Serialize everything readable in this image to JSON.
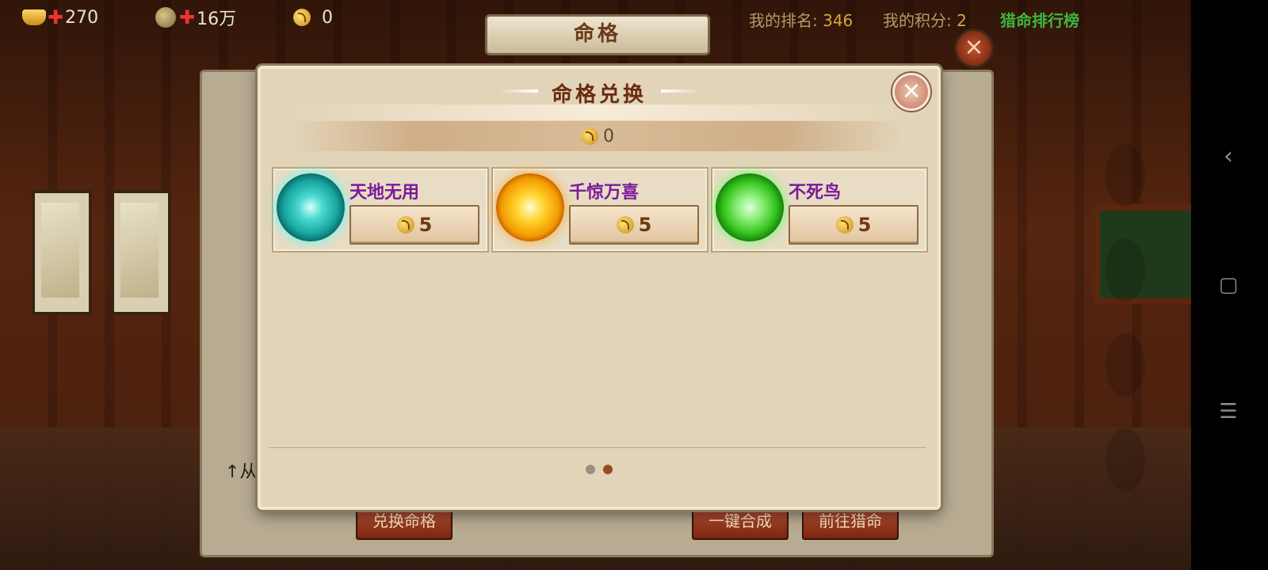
{
  "topbar": {
    "gold": "270",
    "coins": "16万",
    "souls": "0",
    "rank_label": "我的排名:",
    "rank_value": "346",
    "score_label": "我的积分:",
    "score_value": "2",
    "rank_list_label": "猎命排行榜"
  },
  "background_panel": {
    "title": "命格",
    "close_icon": "×",
    "hint_text": "↑从",
    "buttons": {
      "exchange": "兑换命格",
      "merge": "一键合成",
      "hunt": "前往猎命"
    }
  },
  "dialog": {
    "title": "命格兑换",
    "close_icon": "×",
    "currency_value": "0",
    "items": [
      {
        "name": "天地无用",
        "price": "5",
        "color": "#3fd9cf"
      },
      {
        "name": "千惊万喜",
        "price": "5",
        "color": "#f5a50a"
      },
      {
        "name": "不死鸟",
        "price": "5",
        "color": "#3ec21f"
      }
    ],
    "pages": {
      "count": 2,
      "current": 2
    }
  },
  "system_nav": {
    "back": "‹",
    "home": "▢",
    "menu": "☰"
  },
  "colors": {
    "item_name": "#7a1a9a",
    "rank_title": "#3fb53f",
    "accent": "#6a2a10"
  }
}
